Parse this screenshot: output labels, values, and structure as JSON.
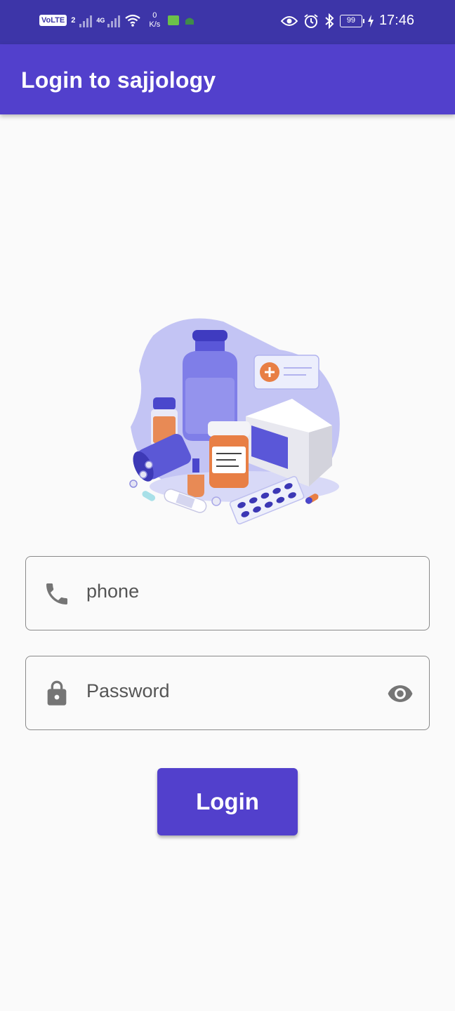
{
  "status_bar": {
    "volte": "VoLTE",
    "sim": "2",
    "network": "4G",
    "speed_value": "0",
    "speed_unit": "K/s",
    "battery": "99",
    "time": "17:46"
  },
  "app_bar": {
    "title": "Login to sajjology"
  },
  "form": {
    "phone_placeholder": "phone",
    "password_placeholder": "Password",
    "login_label": "Login"
  },
  "colors": {
    "status_bar": "#3d35a8",
    "primary": "#5240cc",
    "background": "#fafafa"
  },
  "icons": {
    "phone": "phone-icon",
    "password": "lock-icon",
    "visibility": "eye-icon"
  }
}
